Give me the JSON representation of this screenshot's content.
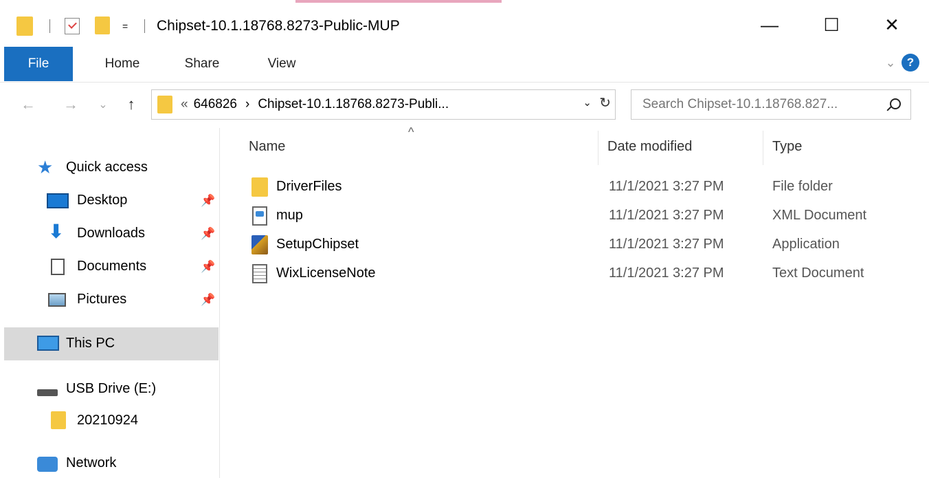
{
  "window": {
    "title": "Chipset-10.1.18768.8273-Public-MUP",
    "qa_dropdown": "=",
    "minimize": "—",
    "maximize": "☐",
    "close": "✕"
  },
  "ribbon": {
    "tabs": [
      "File",
      "Home",
      "Share",
      "View"
    ],
    "collapse": "⌄",
    "help": "?"
  },
  "nav": {
    "back": "←",
    "forward": "→",
    "recent": "⌄",
    "up": "↑",
    "address": {
      "overflow": "«",
      "crumbs": [
        "646826",
        "Chipset-10.1.18768.8273-Publi..."
      ],
      "separator": "›",
      "dropdown": "⌄",
      "refresh": "↻"
    },
    "search_placeholder": "Search Chipset-10.1.18768.827..."
  },
  "sidebar": {
    "quick_access": "Quick access",
    "items": [
      {
        "label": "Desktop",
        "icon": "desktop-icon",
        "pinned": true
      },
      {
        "label": "Downloads",
        "icon": "downloads-icon",
        "pinned": true
      },
      {
        "label": "Documents",
        "icon": "documents-icon",
        "pinned": true
      },
      {
        "label": "Pictures",
        "icon": "pictures-icon",
        "pinned": true
      }
    ],
    "pin_glyph": "📌",
    "this_pc": "This PC",
    "usb_drive": "USB Drive (E:)",
    "usb_folder": "20210924",
    "network": "Network"
  },
  "main": {
    "sort_indicator": "^",
    "columns": [
      "Name",
      "Date modified",
      "Type"
    ],
    "files": [
      {
        "name": "DriverFiles",
        "date": "11/1/2021 3:27 PM",
        "type": "File folder",
        "icon": "folder-icon"
      },
      {
        "name": "mup",
        "date": "11/1/2021 3:27 PM",
        "type": "XML Document",
        "icon": "xml-document-icon"
      },
      {
        "name": "SetupChipset",
        "date": "11/1/2021 3:27 PM",
        "type": "Application",
        "icon": "application-icon"
      },
      {
        "name": "WixLicenseNote",
        "date": "11/1/2021 3:27 PM",
        "type": "Text Document",
        "icon": "text-document-icon"
      }
    ]
  },
  "colors": {
    "accent": "#1a6fc0",
    "folder": "#f5c842",
    "selection": "#d9d9d9"
  }
}
